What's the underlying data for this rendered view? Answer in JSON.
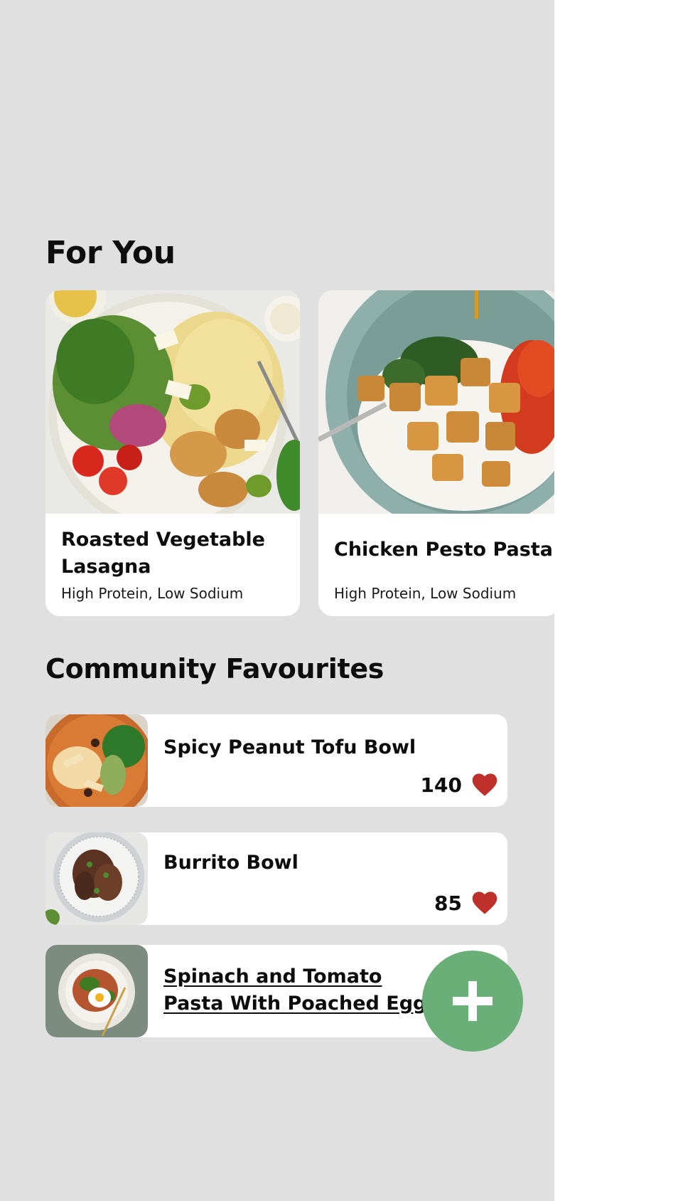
{
  "for_you": {
    "title": "For You",
    "cards": [
      {
        "name": "Roasted Vegetable Lasagna",
        "tags": "High Protein, Low Sodium",
        "image": "pasta-salad-bowl-photo"
      },
      {
        "name": "Chicken Pesto Pasta",
        "tags": "High Protein, Low Sodium",
        "image": "tofu-rice-bowl-photo"
      }
    ]
  },
  "community": {
    "title": "Community Favourites",
    "items": [
      {
        "name": "Spicy Peanut Tofu Bowl",
        "likes": "140",
        "image": "noodle-soup-photo"
      },
      {
        "name": "Burrito Bowl",
        "likes": "85",
        "image": "mushroom-plate-photo"
      },
      {
        "name": "Spinach and Tomato Pasta With Poached Egg",
        "image": "pasta-egg-photo"
      }
    ]
  },
  "colors": {
    "background": "#e0e0e0",
    "card": "#ffffff",
    "heart": "#c0302a",
    "fab": "#6aaf78"
  },
  "icons": {
    "like": "heart-icon",
    "fab": "plus-icon"
  }
}
